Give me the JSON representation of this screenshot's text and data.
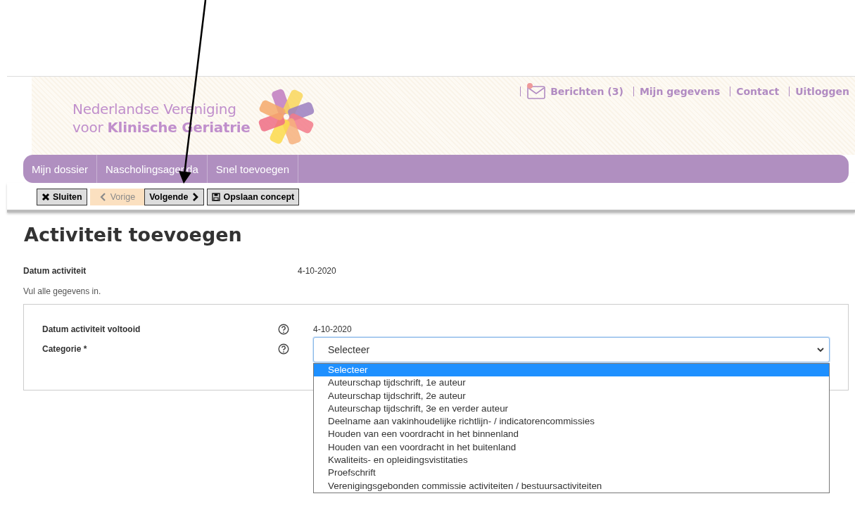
{
  "header": {
    "logo_line1": "Nederlandse Vereniging",
    "logo_line2_prefix": "voor ",
    "logo_line2_bold": "Klinische Geriatrie",
    "links": [
      {
        "kind": "messages",
        "label": "Berichten (3)",
        "unread": true
      },
      {
        "kind": "link",
        "label": "Mijn gegevens"
      },
      {
        "kind": "link",
        "label": "Contact"
      },
      {
        "kind": "link",
        "label": "Uitloggen"
      }
    ]
  },
  "nav": [
    {
      "label": "Mijn dossier"
    },
    {
      "label": "Nascholingsagenda"
    },
    {
      "label": "Snel toevoegen"
    }
  ],
  "toolbar": [
    {
      "kind": "close",
      "label": "Sluiten",
      "disabled": false
    },
    {
      "kind": "prev",
      "label": "Vorige",
      "disabled": true
    },
    {
      "kind": "next",
      "label": "Volgende",
      "disabled": false
    },
    {
      "kind": "save",
      "label": "Opslaan concept",
      "disabled": false
    }
  ],
  "page_title": "Activiteit toevoegen",
  "summary": {
    "label": "Datum activiteit",
    "value": "4-10-2020"
  },
  "instruction": "Vul alle gegevens in.",
  "form": [
    {
      "kind": "text",
      "label": "Datum activiteit voltooid",
      "value": "4-10-2020"
    },
    {
      "kind": "select",
      "label": "Categorie *",
      "value": "Selecteer",
      "expanded": true,
      "options": [
        {
          "label": "Selecteer",
          "selected": true
        },
        {
          "label": "Auteurschap tijdschrift, 1e auteur",
          "selected": false
        },
        {
          "label": "Auteurschap tijdschrift, 2e auteur",
          "selected": false
        },
        {
          "label": "Auteurschap tijdschrift, 3e en verder auteur",
          "selected": false
        },
        {
          "label": "Deelname aan vakinhoudelijke richtlijn- / indicatorencommissies",
          "selected": false
        },
        {
          "label": "Houden van een voordracht in het binnenland",
          "selected": false
        },
        {
          "label": "Houden van een voordracht in het buitenland",
          "selected": false
        },
        {
          "label": "Kwaliteits- en opleidingsvistitaties",
          "selected": false
        },
        {
          "label": "Proefschrift",
          "selected": false
        },
        {
          "label": "Verenigingsgebonden commissie activiteiten / bestuursactiviteiten",
          "selected": false
        }
      ]
    }
  ]
}
